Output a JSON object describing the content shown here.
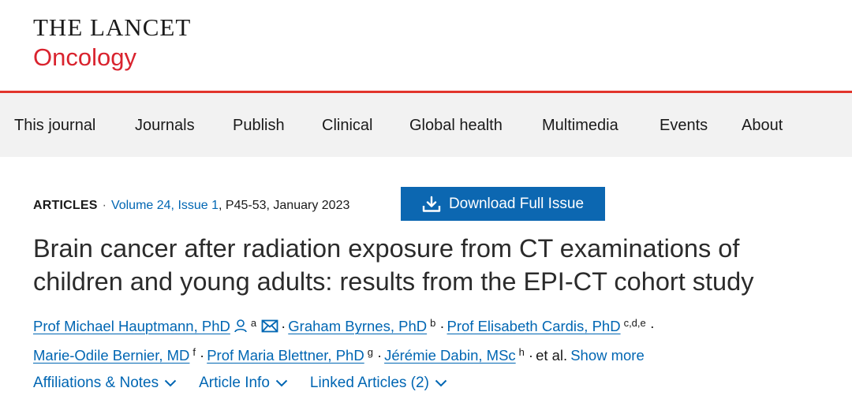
{
  "brand": {
    "top": "THE LANCET",
    "bottom": "Oncology",
    "accent_color": "#d9232e"
  },
  "nav": {
    "items": [
      {
        "label": "This journal"
      },
      {
        "label": "Journals"
      },
      {
        "label": "Publish"
      },
      {
        "label": "Clinical"
      },
      {
        "label": "Global health"
      },
      {
        "label": "Multimedia"
      },
      {
        "label": "Events"
      },
      {
        "label": "About"
      }
    ]
  },
  "article": {
    "type": "ARTICLES",
    "separator": "·",
    "issue_link": "Volume 24, Issue 1",
    "pages_date": ", P45-53, January 2023",
    "download_label": "Download Full Issue",
    "title": "Brain cancer after radiation exposure from CT examinations of children and young adults: results from the EPI-CT cohort study",
    "authors": [
      {
        "name": "Prof Michael Hauptmann, PhD",
        "aff": "a",
        "icons": [
          "person-icon",
          "email-icon"
        ]
      },
      {
        "name": "Graham Byrnes, PhD",
        "aff": "b"
      },
      {
        "name": "Prof Elisabeth Cardis, PhD",
        "aff": "c,d,e"
      },
      {
        "name": "Marie-Odile Bernier, MD",
        "aff": "f"
      },
      {
        "name": "Prof Maria Blettner, PhD",
        "aff": "g"
      },
      {
        "name": "Jérémie Dabin, MSc",
        "aff": "h"
      }
    ],
    "et_al": "et al.",
    "show_more": "Show more",
    "links": [
      {
        "label": "Affiliations & Notes"
      },
      {
        "label": "Article Info"
      },
      {
        "label": "Linked Articles (2)"
      }
    ],
    "link_color": "#0066b3",
    "button_color": "#0c67b1"
  }
}
